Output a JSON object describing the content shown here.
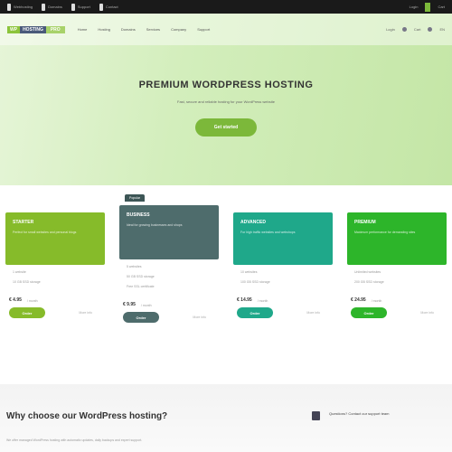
{
  "topbar": {
    "items": [
      "Webhosting",
      "Domains",
      "Support",
      "Contact"
    ],
    "right": [
      "Login",
      "Cart"
    ]
  },
  "nav": {
    "logo": [
      "WP",
      "HOSTING",
      "PRO"
    ],
    "menu": [
      "Home",
      "Hosting",
      "Domains",
      "Services",
      "Company",
      "Support"
    ],
    "right": [
      "Login",
      "Cart",
      "EN"
    ]
  },
  "hero": {
    "title": "PREMIUM WORDPRESS HOSTING",
    "subtitle": "Fast, secure and reliable hosting for your WordPress website",
    "cta": "Get started"
  },
  "plans": [
    {
      "name": "STARTER",
      "desc": "Perfect for small websites and personal blogs",
      "features": [
        "1 website",
        "10 GB SSD storage"
      ],
      "price": "€ 4.95",
      "per": "/ month",
      "buy": "Order",
      "more": "More info",
      "color": "#86bb2a"
    },
    {
      "name": "BUSINESS",
      "desc": "Ideal for growing businesses and shops",
      "features": [
        "5 websites",
        "50 GB SSD storage",
        "Free SSL certificate"
      ],
      "price": "€ 9.95",
      "per": "/ month",
      "buy": "Order",
      "more": "More info",
      "color": "#4e6c6c",
      "badge": "Popular"
    },
    {
      "name": "ADVANCED",
      "desc": "For high traffic websites and webshops",
      "features": [
        "10 websites",
        "100 GB SSD storage"
      ],
      "price": "€ 14.95",
      "per": "/ month",
      "buy": "Order",
      "more": "More info",
      "color": "#1fa88a"
    },
    {
      "name": "PREMIUM",
      "desc": "Maximum performance for demanding sites",
      "features": [
        "Unlimited websites",
        "200 GB SSD storage"
      ],
      "price": "€ 24.95",
      "per": "/ month",
      "buy": "Order",
      "more": "More info",
      "color": "#2db52a"
    }
  ],
  "bottom": {
    "title": "Why choose our WordPress hosting?",
    "text": "We offer managed WordPress hosting with automatic updates, daily backups and expert support.",
    "side": "Questions? Contact our support team"
  }
}
